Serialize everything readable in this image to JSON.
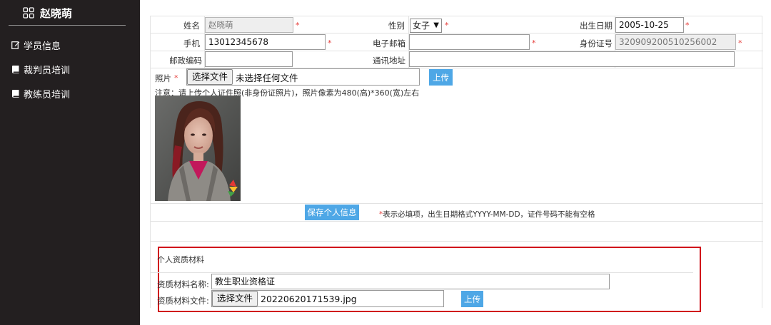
{
  "sidebar": {
    "title": "赵晓萌",
    "items": [
      {
        "label": "学员信息",
        "icon": "edit-icon"
      },
      {
        "label": "裁判员培训",
        "icon": "book-icon"
      },
      {
        "label": "教练员培训",
        "icon": "book-icon"
      }
    ]
  },
  "form": {
    "name_label": "姓名",
    "name_value": "赵晓萌",
    "gender_label": "性别",
    "gender_value": "女子",
    "birth_label": "出生日期",
    "birth_value": "2005-10-25",
    "phone_label": "手机",
    "phone_value": "13012345678",
    "email_label": "电子邮箱",
    "email_value": "",
    "idcard_label": "身份证号",
    "idcard_value": "320909200510256002",
    "postcode_label": "邮政编码",
    "postcode_value": "",
    "address_label": "通讯地址",
    "address_value": "",
    "required_mark": "*",
    "photo_label": "照片",
    "photo_choose": "选择文件",
    "photo_file": "未选择任何文件",
    "photo_upload": "上传",
    "photo_note": "注意：请上传个人证件照(非身份证照片)，照片像素为480(高)*360(宽)左右",
    "save_button": "保存个人信息",
    "hint_star": "*",
    "hint_text": "表示必填项，出生日期格式YYYY-MM-DD，证件号码不能有空格"
  },
  "qualification": {
    "section_title": "个人资质材料",
    "name_label": "资质材料名称:",
    "name_value": "教生职业资格证",
    "file_label": "资质材料文件:",
    "file_choose": "选择文件",
    "file_value": "20220620171539.jpg",
    "upload": "上传"
  },
  "colors": {
    "sidebar_bg": "#231f20",
    "accent_blue": "#4ea7e6",
    "required_red": "#e53935",
    "highlight_box": "#d0111b"
  }
}
